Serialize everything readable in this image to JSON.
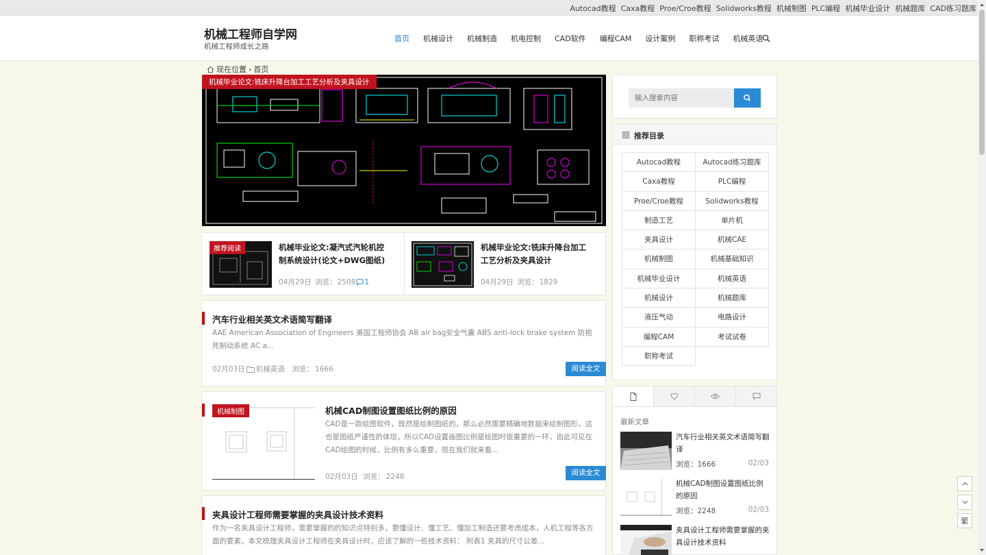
{
  "topbar": {
    "links": [
      "Autocad教程",
      "Caxa教程",
      "Proe/Croe教程",
      "Solidworks教程",
      "机械制图",
      "PLC编程",
      "机械毕业设计",
      "机械题库",
      "CAD练习题库"
    ]
  },
  "header": {
    "site_title": "机械工程师自学网",
    "site_subtitle": "机械工程师成长之路",
    "nav": [
      "首页",
      "机械设计",
      "机械制造",
      "机电控制",
      "CAD软件",
      "编程CAM",
      "设计案例",
      "职称考试",
      "机械英语"
    ]
  },
  "breadcrumb": {
    "label": "现在位置",
    "separator": "›",
    "current": "首页"
  },
  "hero": {
    "tag": "机械毕业论文:铣床升降台加工工艺分析及夹具设计"
  },
  "recommend": {
    "badge": "推荐阅读",
    "items": [
      {
        "title": "机械毕业论文:凝汽式汽轮机控制系统设计(论文+DWG图纸)",
        "date": "04月29日",
        "views_label": "浏览：",
        "views": "2508",
        "comments": "1"
      },
      {
        "title": "机械毕业论文:铣床升降台加工工艺分析及夹具设计",
        "date": "04月29日",
        "views_label": "浏览：",
        "views": "1829"
      }
    ]
  },
  "articles": [
    {
      "title": "汽车行业相关英文术语简写翻译",
      "desc": "AAE American Association of Engineers 美国工程师协会 AB air bag安全气囊 ABS anti-lock brake system 防抱死制动系统 AC a...",
      "date": "02月03日",
      "category": "机械英语",
      "views_label": "浏览：",
      "views": "1666",
      "button": "阅读全文"
    },
    {
      "tag": "机械制图",
      "title": "机械CAD制图设置图纸比例的原因",
      "desc": "CAD是一款绘图软件，既然是绘制图纸的，那么必然需要精确地数据来绘制图形，这也是图纸严谨性的体现，所以CAD设置画图比例是绘图时很重要的一环，由此可见在CAD绘图的时候，比例有多么重要，现在我们就来看...",
      "date": "02月03日",
      "views_label": "浏览：",
      "views": "2248",
      "button": "阅读全文"
    },
    {
      "title": "夹具设计工程师需要掌握的夹具设计技术资料",
      "desc": "作为一名夹具设计工程师，需要掌握的的知识点特别多，要懂设计、懂工艺、懂加工制造还要考虑成本，人机工程等各方面的要素，本文梳理夹具设计工程师在夹具设计时，应该了解的一些技术资料： 附表1 夹具的尺寸公差..."
    }
  ],
  "sidebar": {
    "search_placeholder": "输入搜索内容",
    "catalog_title": "推荐目录",
    "catalog": [
      "Autocad教程",
      "Autocad练习题库",
      "Caxa教程",
      "PLC编程",
      "Proe/Croe教程",
      "Solidworks教程",
      "制造工艺",
      "单片机",
      "夹具设计",
      "机械CAE",
      "机械制图",
      "机械基础知识",
      "机械毕业设计",
      "机械英语",
      "机械设计",
      "机械题库",
      "液压气动",
      "电路设计",
      "编程CAM",
      "考试试卷",
      "职称考试"
    ],
    "latest_label": "最新文章",
    "latest": [
      {
        "title": "汽车行业相关英文术语简写翻译",
        "views": "浏览：1666",
        "date": "02/03"
      },
      {
        "title": "机械CAD制图设置图纸比例的原因",
        "views": "浏览：2248",
        "date": "02/03"
      },
      {
        "title": "夹具设计工程师需要掌握的夹具设计技术资料"
      }
    ]
  },
  "float": {
    "trad": "繁"
  },
  "colors": {
    "accent": "#2a8ad4",
    "tag_red": "#c1131f",
    "page_bg": "#f8f8ea"
  }
}
